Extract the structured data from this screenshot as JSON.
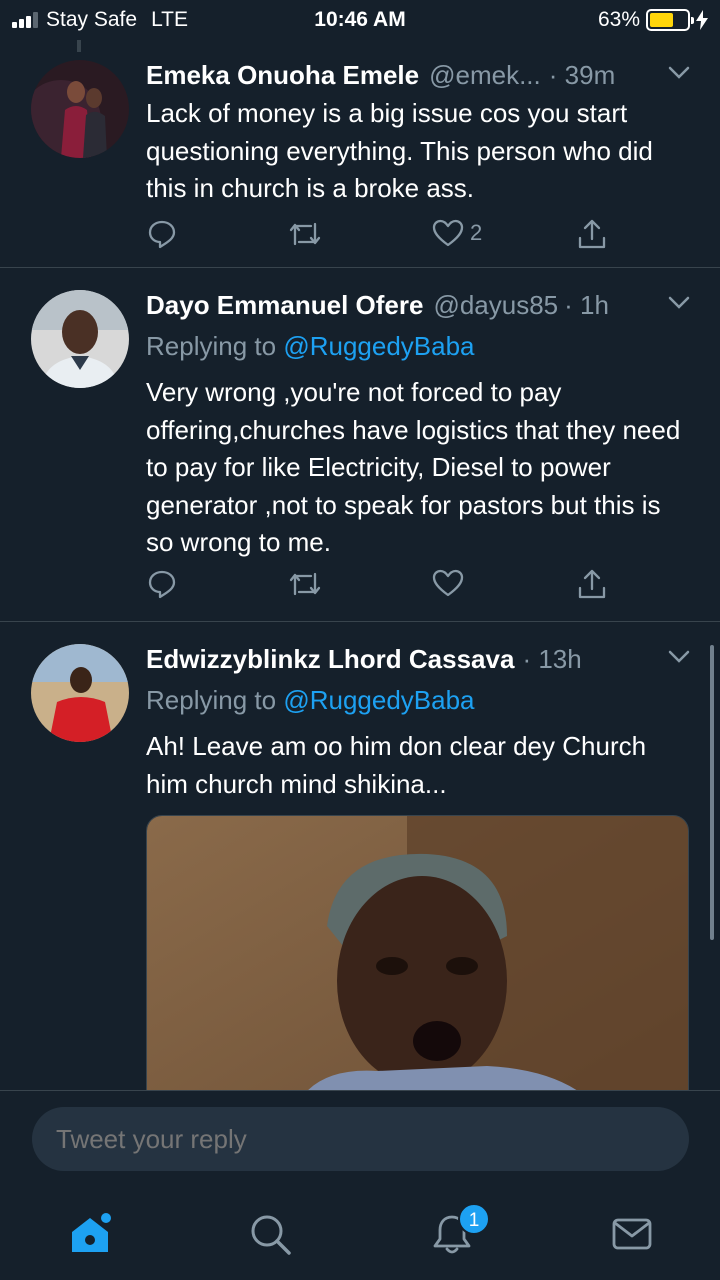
{
  "status_bar": {
    "carrier": "Stay Safe",
    "network": "LTE",
    "time": "10:46 AM",
    "battery_percent": "63%",
    "battery_level": 0.63,
    "signal_bars": 3
  },
  "tweets": [
    {
      "name": "Emeka Onuoha Emele",
      "handle": "@emek...",
      "time": "· 39m",
      "replying_label": "",
      "replying_handle": "",
      "text": "Lack of money is a big issue cos you start questioning everything. This person who did this in church is a broke ass.",
      "like_count": "2"
    },
    {
      "name": "Dayo Emmanuel Ofere",
      "handle": "@dayus85",
      "time": "· 1h",
      "replying_label": "Replying to",
      "replying_handle": "@RuggedyBaba",
      "text": "Very wrong ,you're not forced to pay offering,churches have logistics that they need to pay for like Electricity, Diesel to power generator ,not to speak for pastors but this is so wrong to me.",
      "like_count": ""
    },
    {
      "name": "Edwizzyblinkz Lhord Cassava",
      "handle": "",
      "time": "· 13h",
      "replying_label": "Replying to",
      "replying_handle": "@RuggedyBaba",
      "text": "Ah! Leave am oo him don clear dey Church him church mind shikina...",
      "like_count": ""
    }
  ],
  "composer": {
    "placeholder": "Tweet your reply"
  },
  "tabbar": {
    "notifications_badge": "1"
  },
  "colors": {
    "background": "#15202b",
    "accent": "#1da1f2",
    "muted": "#8899a6",
    "divider": "#38444d",
    "battery": "#ffd60a"
  },
  "icons": [
    "reply-icon",
    "retweet-icon",
    "like-icon",
    "share-icon",
    "chevron-down-icon",
    "home-icon",
    "search-icon",
    "notifications-icon",
    "messages-icon"
  ]
}
